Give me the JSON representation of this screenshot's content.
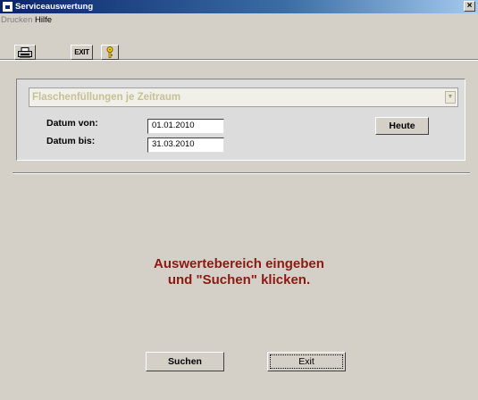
{
  "window": {
    "title": "Serviceauswertung",
    "close_glyph": "×"
  },
  "menu": {
    "items": [
      {
        "label": "Drucken",
        "disabled": true
      },
      {
        "label": "Hilfe",
        "disabled": false
      }
    ]
  },
  "toolbar": {
    "print_icon": "printer-icon",
    "exit_label": "EXIT",
    "help_icon": "key-help-icon"
  },
  "filter": {
    "report_type": "Flaschenfüllungen je Zeitraum",
    "date_from_label": "Datum von:",
    "date_from_value": "01.01.2010",
    "date_to_label": "Datum bis:",
    "date_to_value": "31.03.2010",
    "today_button": "Heute"
  },
  "result": {
    "message_line1": "Auswertebereich eingeben",
    "message_line2": "und \"Suchen\" klicken.",
    "message_color": "#8b1a10"
  },
  "actions": {
    "search_button": "Suchen",
    "exit_button": "Exit"
  }
}
